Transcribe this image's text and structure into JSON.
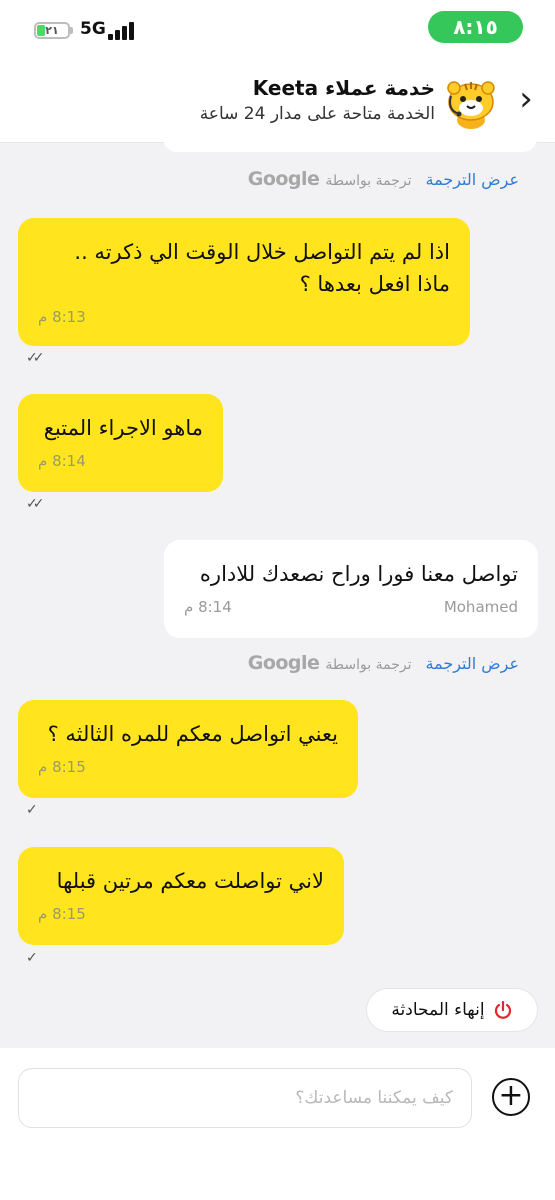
{
  "status_bar": {
    "time": "٨:١٥",
    "battery": "٢١",
    "network": "5G"
  },
  "header": {
    "title": "خدمة عملاء Keeta",
    "subtitle": "الخدمة متاحة على مدار 24 ساعة"
  },
  "translation": {
    "show_label": "عرض الترجمة",
    "translated_by": "ترجمة بواسطة",
    "provider": "Google"
  },
  "messages": [
    {
      "side": "user",
      "text": "اذا لم يتم التواصل خلال الوقت الي ذكرته .. ماذا افعل بعدها ؟",
      "time": "8:13 م",
      "status": "read"
    },
    {
      "side": "user",
      "text": "ماهو الاجراء المتبع",
      "time": "8:14 م",
      "status": "read"
    },
    {
      "side": "agent",
      "text": "تواصل معنا فورا وراح نصعدك للاداره",
      "time": "8:14 م",
      "sender": "Mohamed"
    },
    {
      "side": "user",
      "text": "يعني اتواصل معكم للمره الثالثه ؟",
      "time": "8:15 م",
      "status": "sent"
    },
    {
      "side": "user",
      "text": "لاني تواصلت معكم مرتين قبلها",
      "time": "8:15 م",
      "status": "sent"
    }
  ],
  "end_chat": {
    "label": "إنهاء المحادثة"
  },
  "composer": {
    "placeholder": "كيف يمكننا مساعدتك؟"
  },
  "colors": {
    "user_bubble": "#ffe41e",
    "agent_bubble": "#ffffff",
    "link": "#2f7bd8",
    "end_icon": "#e0282e",
    "time_pill": "#35c759"
  }
}
